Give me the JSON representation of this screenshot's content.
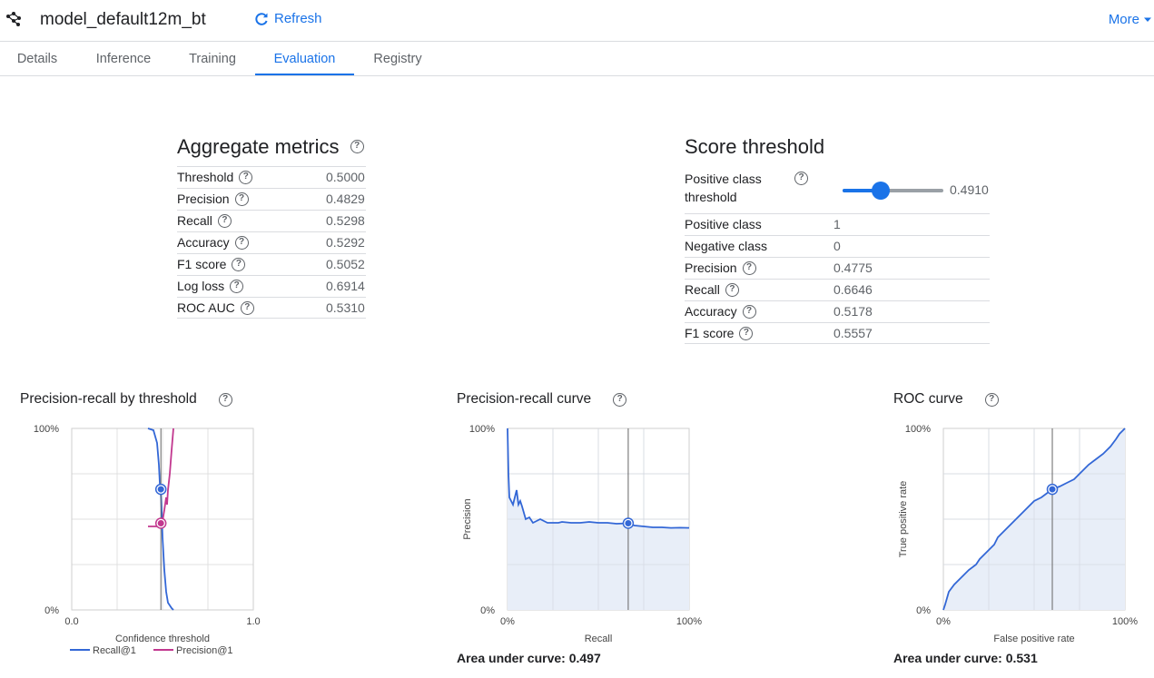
{
  "header": {
    "model_name": "model_default12m_bt",
    "refresh_label": "Refresh",
    "more_label": "More"
  },
  "tabs": [
    {
      "label": "Details",
      "active": false
    },
    {
      "label": "Inference",
      "active": false
    },
    {
      "label": "Training",
      "active": false
    },
    {
      "label": "Evaluation",
      "active": true
    },
    {
      "label": "Registry",
      "active": false
    }
  ],
  "aggregate": {
    "title": "Aggregate metrics",
    "rows": [
      {
        "label": "Threshold",
        "value": "0.5000"
      },
      {
        "label": "Precision",
        "value": "0.4829"
      },
      {
        "label": "Recall",
        "value": "0.5298"
      },
      {
        "label": "Accuracy",
        "value": "0.5292"
      },
      {
        "label": "F1 score",
        "value": "0.5052"
      },
      {
        "label": "Log loss",
        "value": "0.6914"
      },
      {
        "label": "ROC AUC",
        "value": "0.5310"
      }
    ]
  },
  "score_threshold": {
    "title": "Score threshold",
    "slider_label": "Positive class threshold",
    "slider_value": "0.4910",
    "slider_fraction": 0.491,
    "rows": [
      {
        "label": "Positive class",
        "value": "1",
        "help": false
      },
      {
        "label": "Negative class",
        "value": "0",
        "help": false
      },
      {
        "label": "Precision",
        "value": "0.4775",
        "help": true
      },
      {
        "label": "Recall",
        "value": "0.6646",
        "help": true
      },
      {
        "label": "Accuracy",
        "value": "0.5178",
        "help": true
      },
      {
        "label": "F1 score",
        "value": "0.5557",
        "help": true
      }
    ]
  },
  "charts": {
    "pr_threshold": {
      "title": "Precision-recall by threshold"
    },
    "pr_curve": {
      "title": "Precision-recall curve",
      "auc_text": "Area under curve: 0.497"
    },
    "roc": {
      "title": "ROC curve",
      "auc_text": "Area under curve: 0.531"
    }
  },
  "colors": {
    "accent": "#1a73e8",
    "recall": "#3367d6",
    "precision": "#c2388f",
    "fill": "#e8eef8"
  },
  "chart_data": [
    {
      "type": "line",
      "title": "Precision-recall by threshold",
      "xlabel": "Confidence threshold",
      "ylabel": "",
      "xlim": [
        0,
        1
      ],
      "ylim": [
        0,
        100
      ],
      "x_ticks": [
        "0.0",
        "1.0"
      ],
      "y_ticks": [
        "0%",
        "100%"
      ],
      "legend": "bottom",
      "marker_x": 0.491,
      "series": [
        {
          "name": "Recall@1",
          "x": [
            0.42,
            0.45,
            0.47,
            0.48,
            0.485,
            0.49,
            0.495,
            0.5,
            0.51,
            0.52,
            0.53,
            0.55,
            0.56
          ],
          "y": [
            100,
            99,
            92,
            80,
            70,
            66,
            55,
            40,
            22,
            10,
            4,
            1,
            0
          ]
        },
        {
          "name": "Precision@1",
          "x": [
            0.42,
            0.45,
            0.47,
            0.48,
            0.49,
            0.5,
            0.51,
            0.52,
            0.525,
            0.53,
            0.54,
            0.55,
            0.56
          ],
          "y": [
            46,
            46,
            46,
            47,
            48,
            49,
            55,
            62,
            58,
            66,
            75,
            88,
            100
          ]
        }
      ]
    },
    {
      "type": "area",
      "title": "Precision-recall curve",
      "xlabel": "Recall",
      "ylabel": "Precision",
      "xlim": [
        0,
        100
      ],
      "ylim": [
        0,
        100
      ],
      "x_ticks": [
        "0%",
        "100%"
      ],
      "y_ticks": [
        "0%",
        "100%"
      ],
      "marker": {
        "x": 66.46,
        "y": 47.75
      },
      "series": [
        {
          "name": "",
          "x": [
            0,
            0.5,
            1,
            2,
            3,
            4,
            5,
            6,
            7,
            8,
            10,
            12,
            14,
            16,
            18,
            20,
            22,
            25,
            28,
            30,
            35,
            40,
            45,
            50,
            55,
            60,
            65,
            70,
            75,
            80,
            85,
            90,
            95,
            100
          ],
          "y": [
            100,
            75,
            62,
            60,
            58,
            62,
            66,
            58,
            60,
            57,
            50,
            51,
            48,
            49,
            50,
            49,
            48,
            48,
            48,
            48.5,
            48,
            48,
            48.5,
            48,
            48,
            47.5,
            47.7,
            46.5,
            46,
            45.5,
            45.5,
            45.2,
            45.3,
            45.2
          ]
        }
      ]
    },
    {
      "type": "area",
      "title": "ROC curve",
      "xlabel": "False positive rate",
      "ylabel": "True positive rate",
      "xlim": [
        0,
        100
      ],
      "ylim": [
        0,
        100
      ],
      "x_ticks": [
        "0%",
        "100%"
      ],
      "y_ticks": [
        "0%",
        "100%"
      ],
      "marker": {
        "x": 60,
        "y": 66.46
      },
      "series": [
        {
          "name": "",
          "x": [
            0,
            1,
            3,
            6,
            10,
            14,
            18,
            20,
            24,
            28,
            30,
            34,
            38,
            42,
            46,
            50,
            54,
            58,
            60,
            64,
            68,
            72,
            76,
            80,
            84,
            88,
            92,
            95,
            97,
            100
          ],
          "y": [
            0,
            3,
            10,
            14,
            18,
            22,
            25,
            28,
            32,
            36,
            40,
            44,
            48,
            52,
            56,
            60,
            62,
            65,
            66.5,
            68,
            70,
            72,
            76,
            80,
            83,
            86,
            90,
            94,
            97,
            100
          ]
        }
      ]
    }
  ]
}
